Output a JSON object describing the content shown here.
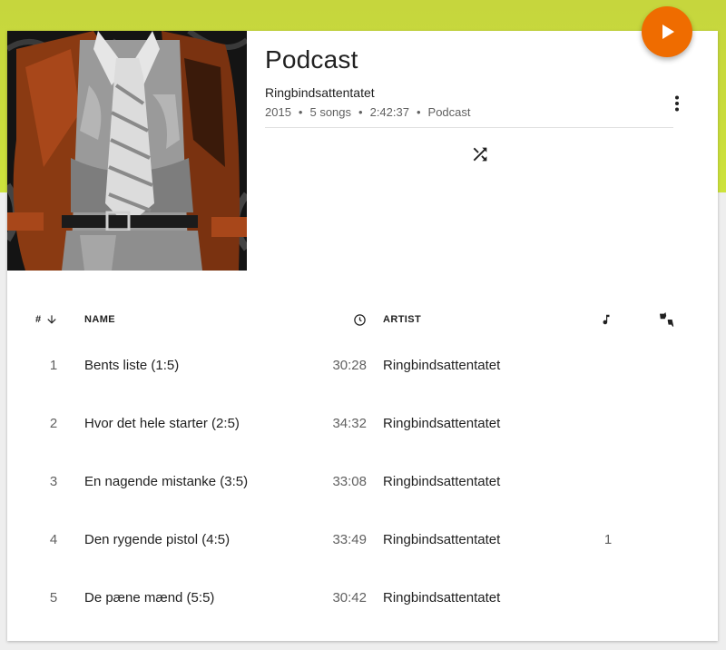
{
  "header": {
    "title": "Podcast",
    "artist": "Ringbindsattentatet",
    "meta": {
      "year": "2015",
      "songs": "5 songs",
      "duration": "2:42:37",
      "genre": "Podcast",
      "separator": "•"
    }
  },
  "colors": {
    "accent": "#ef6c00",
    "top_band": "#c9dc3c"
  },
  "icons": {
    "play": "play-icon",
    "more": "more-vert-icon",
    "shuffle": "shuffle-icon",
    "sort": "arrow-down-icon",
    "duration": "clock-icon",
    "plays": "music-note-icon",
    "thumbs": "thumbs-icon"
  },
  "table": {
    "headers": {
      "num": "#",
      "name": "NAME",
      "artist": "ARTIST"
    },
    "rows": [
      {
        "num": "1",
        "name": "Bents liste (1:5)",
        "duration": "30:28",
        "artist": "Ringbindsattentatet",
        "plays": ""
      },
      {
        "num": "2",
        "name": "Hvor det hele starter (2:5)",
        "duration": "34:32",
        "artist": "Ringbindsattentatet",
        "plays": ""
      },
      {
        "num": "3",
        "name": "En nagende mistanke (3:5)",
        "duration": "33:08",
        "artist": "Ringbindsattentatet",
        "plays": ""
      },
      {
        "num": "4",
        "name": "Den rygende pistol (4:5)",
        "duration": "33:49",
        "artist": "Ringbindsattentatet",
        "plays": "1"
      },
      {
        "num": "5",
        "name": "De pæne mænd (5:5)",
        "duration": "30:42",
        "artist": "Ringbindsattentatet",
        "plays": ""
      }
    ]
  }
}
